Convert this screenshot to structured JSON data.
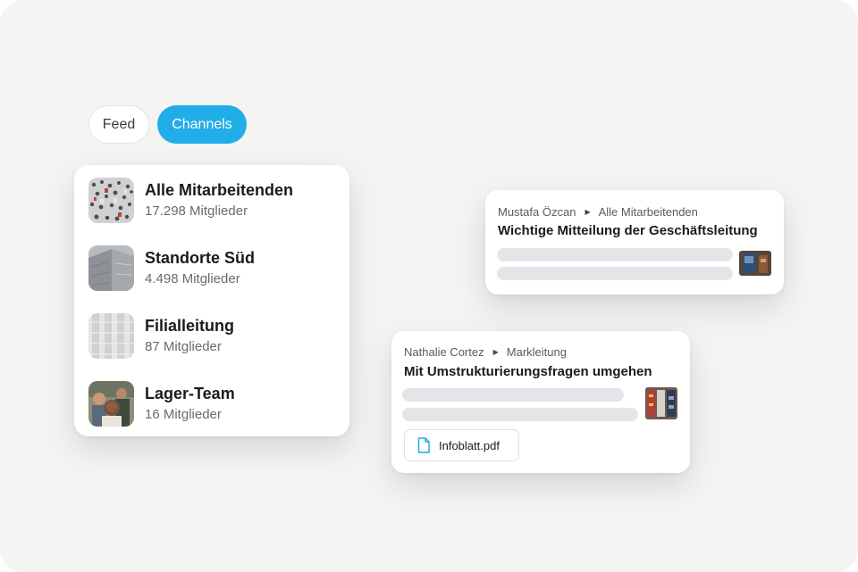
{
  "tabs": [
    {
      "label": "Feed",
      "active": false
    },
    {
      "label": "Channels",
      "active": true
    }
  ],
  "colors": {
    "accent": "#21ade8",
    "background": "#f4f4f2",
    "placeholder_bar": "#e4e5e8"
  },
  "channels": [
    {
      "name": "Alle Mitarbeitenden",
      "members": "17.298 Mitglieder",
      "thumb": "crowd-photo"
    },
    {
      "name": "Standorte Süd",
      "members": "4.498 Mitglieder",
      "thumb": "building-photo"
    },
    {
      "name": "Filialleitung",
      "members": "87 Mitglieder",
      "thumb": "facade-photo"
    },
    {
      "name": "Lager-Team",
      "members": "16 Mitglieder",
      "thumb": "team-selfie-photo"
    }
  ],
  "posts": [
    {
      "author": "Mustafa Özcan",
      "channel": "Alle Mitarbeitenden",
      "title": "Wichtige Mitteilung der Geschäftsleitung",
      "thumb": "office-photo"
    },
    {
      "author": "Nathalie Cortez",
      "channel": "Markleitung",
      "title": "Mit Umstrukturierungsfragen umgehen",
      "thumb": "store-photo",
      "attachment": "Infoblatt.pdf"
    }
  ]
}
